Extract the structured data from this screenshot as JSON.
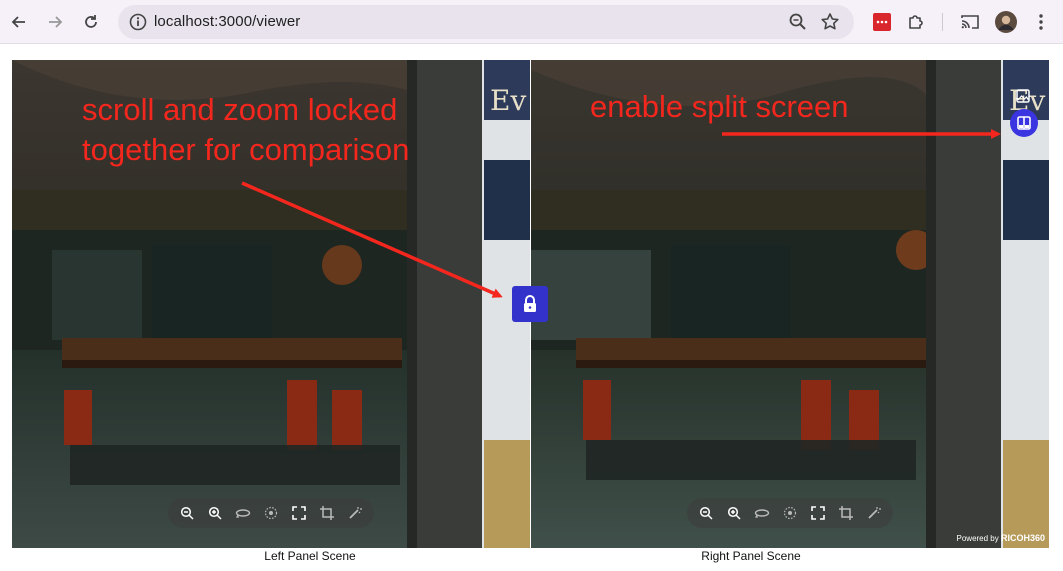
{
  "browser": {
    "url": "localhost:3000/viewer",
    "icons": [
      "back-arrow-icon",
      "forward-arrow-icon",
      "reload-icon",
      "site-info-icon",
      "zoom-icon",
      "bookmark-star-icon",
      "extension-icon",
      "puzzle-extensions-icon",
      "cast-icon",
      "profile-avatar",
      "more-menu-icon"
    ]
  },
  "viewer": {
    "left_label": "Left Panel Scene",
    "right_label": "Right Panel Scene",
    "toolbar_icons": [
      "zoom-out-icon",
      "zoom-in-icon",
      "rotate-icon",
      "gyro-icon",
      "fullscreen-icon",
      "crop-icon",
      "magic-wand-icon"
    ],
    "powered_prefix": "Powered by",
    "powered_brand": "RICOH360"
  },
  "annotations": {
    "left_line1": "scroll and zoom locked",
    "left_line2": "together for comparison",
    "right": "enable split screen"
  },
  "colors": {
    "annotation": "#f3271d",
    "accent": "#3333cc",
    "right_panel_border": "#3a3af0"
  }
}
